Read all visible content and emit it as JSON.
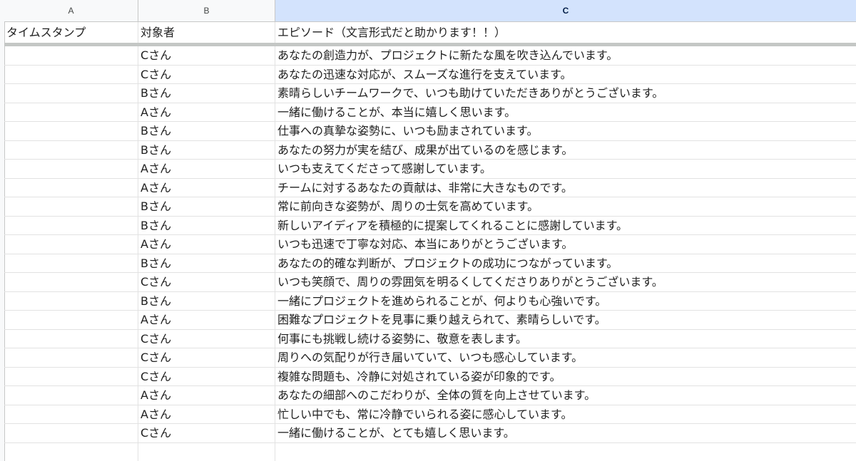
{
  "columns": {
    "a": "A",
    "b": "B",
    "c": "C"
  },
  "header": {
    "timestamp": "タイムスタンプ",
    "target": "対象者",
    "episode": "エピソード（文言形式だと助かります！！）"
  },
  "rows": [
    {
      "target": "Cさん",
      "episode": "あなたの創造力が、プロジェクトに新たな風を吹き込んでいます。"
    },
    {
      "target": "Cさん",
      "episode": "あなたの迅速な対応が、スムーズな進行を支えています。"
    },
    {
      "target": "Bさん",
      "episode": "素晴らしいチームワークで、いつも助けていただきありがとうございます。"
    },
    {
      "target": "Aさん",
      "episode": "一緒に働けることが、本当に嬉しく思います。"
    },
    {
      "target": "Bさん",
      "episode": "仕事への真摯な姿勢に、いつも励まされています。"
    },
    {
      "target": "Bさん",
      "episode": "あなたの努力が実を結び、成果が出ているのを感じます。"
    },
    {
      "target": "Aさん",
      "episode": "いつも支えてくださって感謝しています。"
    },
    {
      "target": "Aさん",
      "episode": "チームに対するあなたの貢献は、非常に大きなものです。"
    },
    {
      "target": "Bさん",
      "episode": "常に前向きな姿勢が、周りの士気を高めています。"
    },
    {
      "target": "Bさん",
      "episode": "新しいアイディアを積極的に提案してくれることに感謝しています。"
    },
    {
      "target": "Aさん",
      "episode": "いつも迅速で丁寧な対応、本当にありがとうございます。"
    },
    {
      "target": "Bさん",
      "episode": "あなたの的確な判断が、プロジェクトの成功につながっています。"
    },
    {
      "target": "Cさん",
      "episode": "いつも笑顔で、周りの雰囲気を明るくしてくださりありがとうございます。"
    },
    {
      "target": "Bさん",
      "episode": "一緒にプロジェクトを進められることが、何よりも心強いです。"
    },
    {
      "target": "Aさん",
      "episode": "困難なプロジェクトを見事に乗り越えられて、素晴らしいです。"
    },
    {
      "target": "Cさん",
      "episode": "何事にも挑戦し続ける姿勢に、敬意を表します。"
    },
    {
      "target": "Cさん",
      "episode": "周りへの気配りが行き届いていて、いつも感心しています。"
    },
    {
      "target": "Cさん",
      "episode": "複雑な問題も、冷静に対処されている姿が印象的です。"
    },
    {
      "target": "Aさん",
      "episode": "あなたの細部へのこだわりが、全体の質を向上させています。"
    },
    {
      "target": "Aさん",
      "episode": "忙しい中でも、常に冷静でいられる姿に感心しています。"
    },
    {
      "target": "Cさん",
      "episode": "一緒に働けることが、とても嬉しく思います。"
    }
  ],
  "colors": {
    "selected_header_bg": "#d3e3fd",
    "grid_line": "#e2e2e2",
    "freeze_bar": "#c4c7c5"
  }
}
